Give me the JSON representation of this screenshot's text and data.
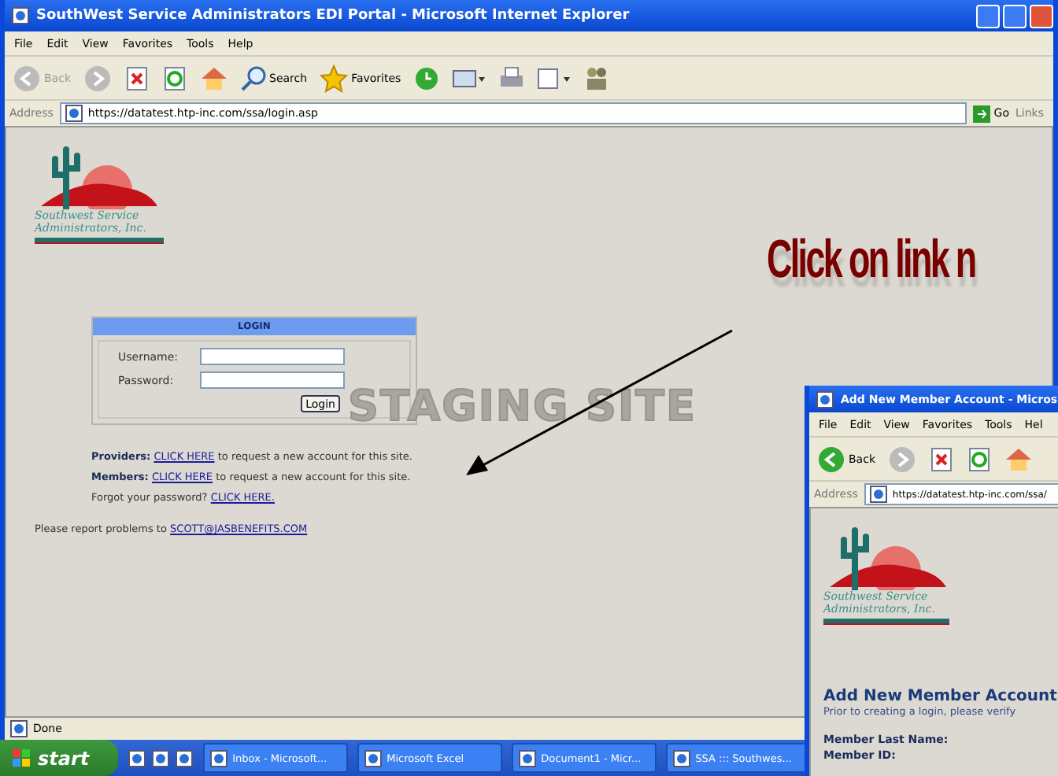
{
  "main_window": {
    "title": "SouthWest Service Administrators EDI Portal - Microsoft Internet Explorer",
    "menu": [
      "File",
      "Edit",
      "View",
      "Favorites",
      "Tools",
      "Help"
    ],
    "toolbar": [
      {
        "kind": "back",
        "label": "Back"
      },
      {
        "kind": "forward"
      },
      {
        "kind": "stop"
      },
      {
        "kind": "refresh"
      },
      {
        "kind": "home"
      },
      {
        "kind": "search",
        "label": "Search"
      },
      {
        "kind": "favorites",
        "label": "Favorites"
      },
      {
        "kind": "history"
      },
      {
        "kind": "mail"
      },
      {
        "kind": "print"
      },
      {
        "kind": "edit"
      },
      {
        "kind": "messenger"
      }
    ],
    "address": {
      "label": "Address",
      "url": "https://datatest.htp-inc.com/ssa/login.asp",
      "go": "Go",
      "links": "Links"
    },
    "status": "Done"
  },
  "page": {
    "logo": [
      "Southwest Service",
      "Administrators, Inc."
    ],
    "login": {
      "title": "LOGIN",
      "fields": [
        {
          "label": "Username:"
        },
        {
          "label": "Password:"
        }
      ],
      "button": "Login"
    },
    "watermark": "STAGING SITE",
    "lines": [
      {
        "lead": "Providers:",
        "bold": true,
        "link": "CLICK HERE",
        "rest": "to request a new account for this site."
      },
      {
        "lead": "Members:",
        "bold": true,
        "link": "CLICK HERE",
        "rest": "to request a new account for this site."
      },
      {
        "lead": "Forgot your password?",
        "bold": false,
        "link": "CLICK HERE."
      }
    ],
    "report": {
      "text": "Please report problems to",
      "link": "SCOTT@JASBENEFITS.COM"
    }
  },
  "annotation": "Click on link n",
  "taskbar": {
    "start": "start",
    "tasks": [
      "Inbox - Microsoft...",
      "Microsoft Excel",
      "Document1 - Micr...",
      "SSA ::: Southwes..."
    ]
  },
  "second_window": {
    "title": "Add New Member Account - Micros",
    "menu": [
      "File",
      "Edit",
      "View",
      "Favorites",
      "Tools",
      "Hel"
    ],
    "back": "Back",
    "address_label": "Address",
    "url": "https://datatest.htp-inc.com/ssa/",
    "logo": [
      "Southwest Service",
      "Administrators, Inc."
    ],
    "heading": "Add New Member Account",
    "intro": "Prior to creating a login, please verify",
    "fields": [
      "Member Last Name:",
      "Member ID:"
    ]
  }
}
